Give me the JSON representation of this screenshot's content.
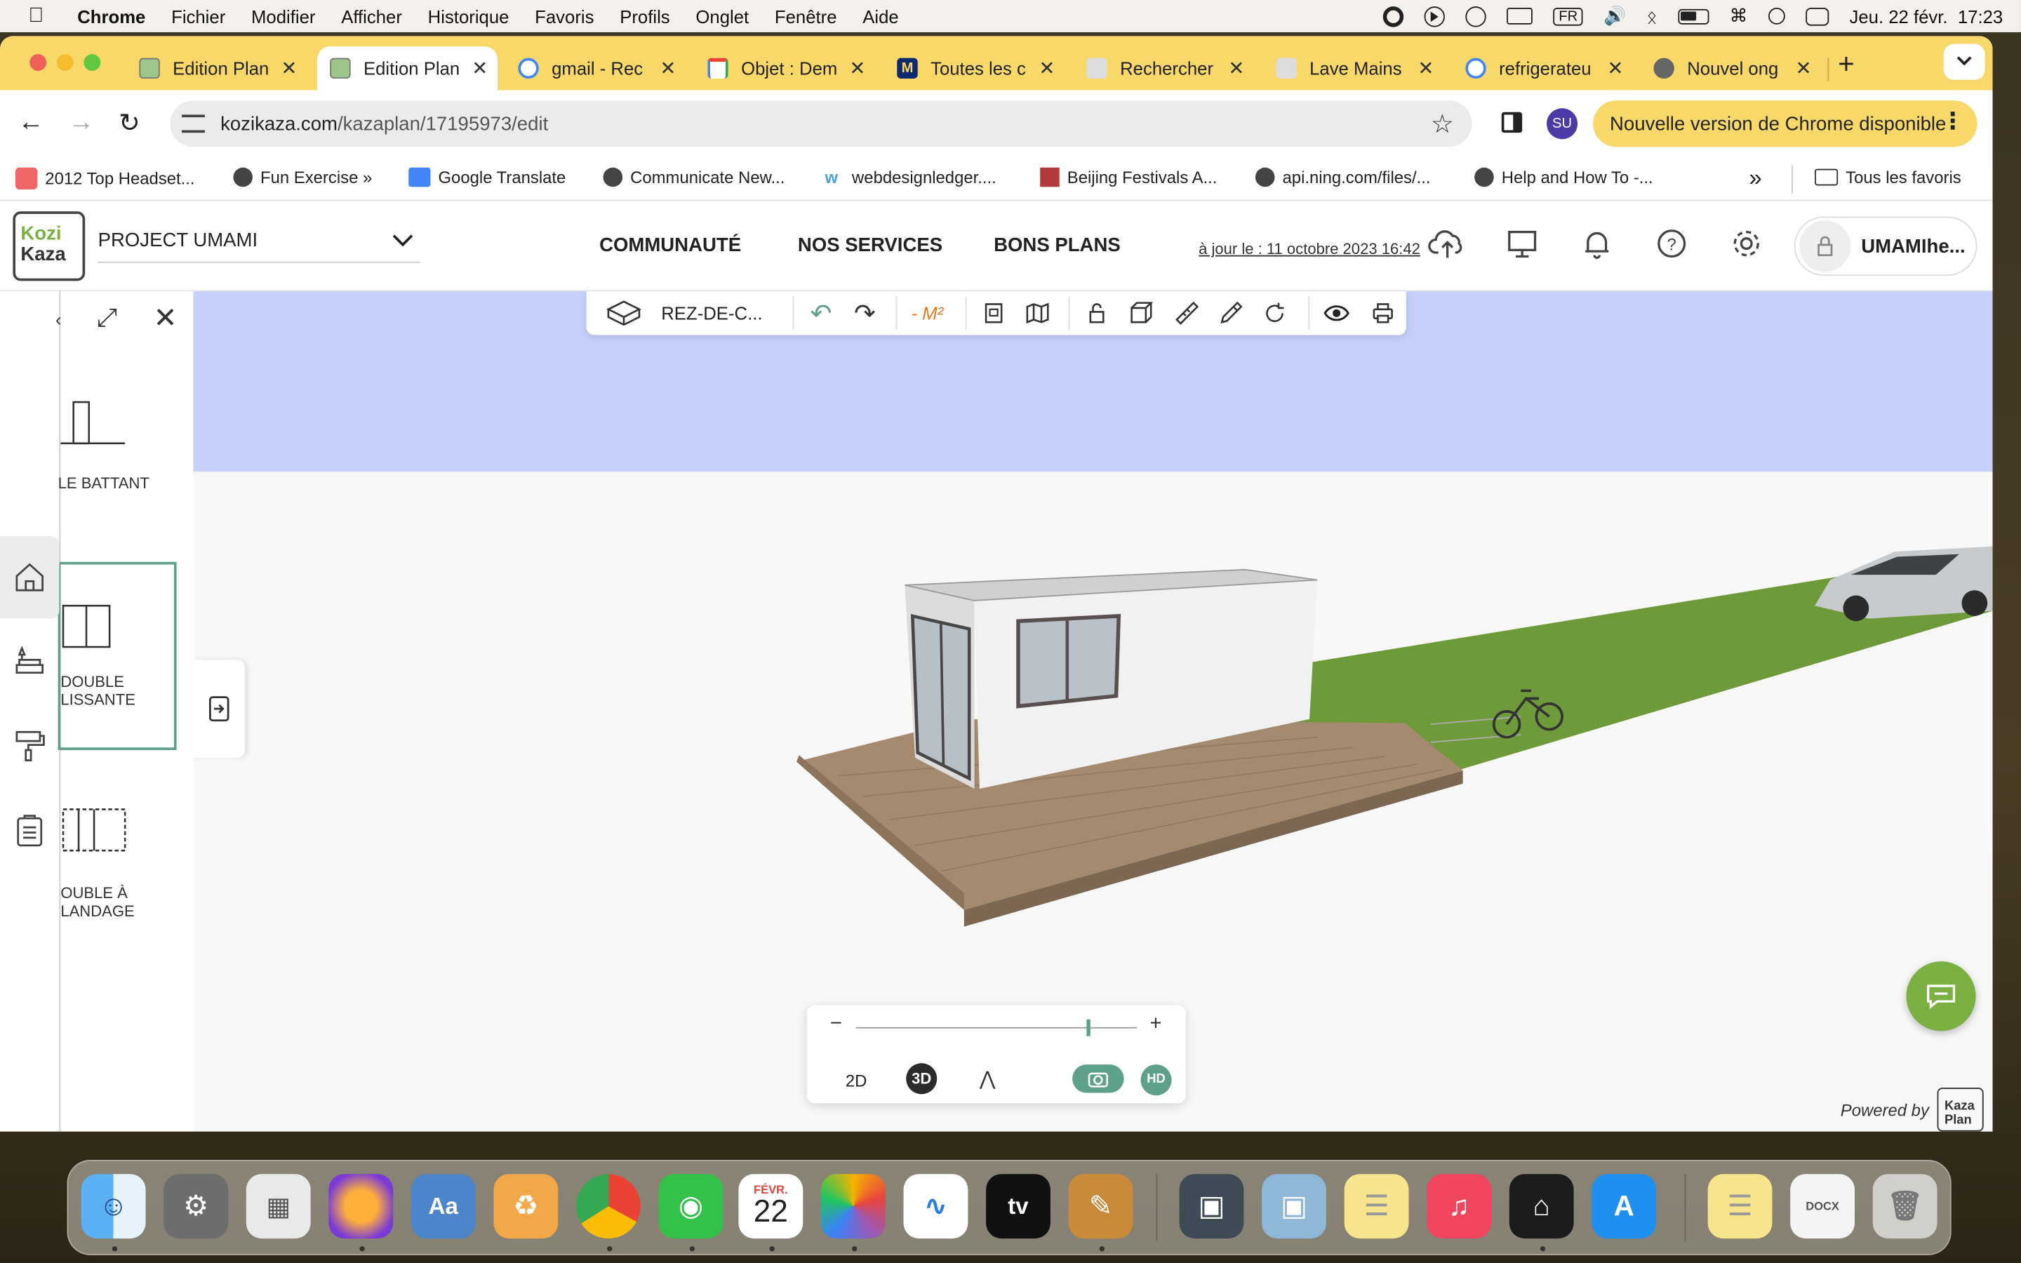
{
  "menubar": {
    "app": "Chrome",
    "items": [
      "Fichier",
      "Modifier",
      "Afficher",
      "Historique",
      "Favoris",
      "Profils",
      "Onglet",
      "Fenêtre",
      "Aide"
    ],
    "input_source": "FR",
    "clock": "Jeu. 22 févr.  17:23"
  },
  "tabs": [
    {
      "title": "Edition Plan",
      "close": "✕"
    },
    {
      "title": "Edition Plan",
      "close": "✕"
    },
    {
      "title": "gmail - Rec",
      "close": "✕"
    },
    {
      "title": "Objet : Dem",
      "close": "✕"
    },
    {
      "title": "Toutes les c",
      "close": "✕"
    },
    {
      "title": "Rechercher",
      "close": "✕"
    },
    {
      "title": "Lave Mains",
      "close": "✕"
    },
    {
      "title": "refrigerateu",
      "close": "✕"
    },
    {
      "title": "Nouvel ong",
      "close": "✕"
    }
  ],
  "new_tab": "+",
  "toolbar": {
    "url_host": "kozikaza.com",
    "url_path": "/kazaplan/17195973/edit",
    "profile_initials": "SU",
    "update_label": "Nouvelle version de Chrome disponible"
  },
  "bookmarks": [
    "2012 Top Headset...",
    "Fun Exercise »",
    "Google Translate",
    "Communicate New...",
    "webdesignledger....",
    "Beijing Festivals A...",
    "api.ning.com/files/...",
    "Help and How To -..."
  ],
  "bookmarks_more": "»",
  "bookmarks_all": "Tous les favoris",
  "app": {
    "logo_line1": "Kozi",
    "logo_line2": "Kaza",
    "project_name": "PROJECT UMAMI",
    "nav": [
      "COMMUNAUTÉ",
      "NOS SERVICES",
      "BONS PLANS"
    ],
    "save_date": "à jour le : 11 octobre 2023 16:42",
    "user_name": "UMAMIhe..."
  },
  "toolstrip": {
    "floor": "REZ-DE-C...",
    "area_unit": "- M²"
  },
  "catalog": {
    "items": [
      {
        "label_line1": "LE BATTANT",
        "label_line2": ""
      },
      {
        "label_line1": "DOUBLE",
        "label_line2": "LISSANTE"
      },
      {
        "label_line1": "OUBLE À",
        "label_line2": "LANDAGE"
      }
    ]
  },
  "view": {
    "zoom_level": 0.82,
    "mode_2d": "2D",
    "mode_3d": "3D",
    "hd": "HD",
    "zoom_minus": "−",
    "zoom_plus": "+",
    "powered_by": "Powered by",
    "powered_logo_1": "Kaza",
    "powered_logo_2": "Plan"
  },
  "dock": {
    "calendar_month": "FÉVR.",
    "calendar_day": "22"
  },
  "colors": {
    "tabstrip": "#f9d86a",
    "sky": "#c6d0fb",
    "grass": "#6e9a3a",
    "deck": "#a48a6e",
    "accent_green": "#5fa08a",
    "chat_green": "#7cb043"
  }
}
